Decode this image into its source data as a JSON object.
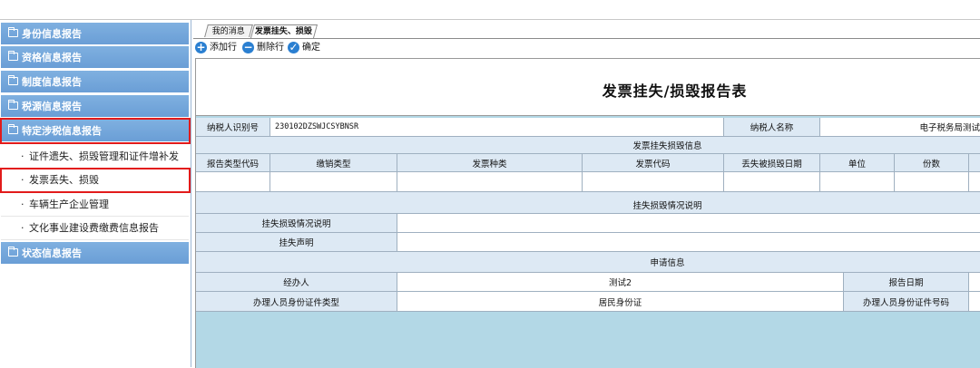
{
  "sidebar": {
    "groups": [
      {
        "label": "身份信息报告"
      },
      {
        "label": "资格信息报告"
      },
      {
        "label": "制度信息报告"
      },
      {
        "label": "税源信息报告"
      },
      {
        "label": "特定涉税信息报告"
      },
      {
        "label": "状态信息报告"
      }
    ],
    "items": [
      {
        "bullet": "·",
        "label": "证件遗失、损毁管理和证件增补发"
      },
      {
        "bullet": "·",
        "label": "发票丢失、损毁"
      },
      {
        "bullet": "·",
        "label": "车辆生产企业管理"
      },
      {
        "bullet": "·",
        "label": "文化事业建设费缴费信息报告"
      }
    ]
  },
  "tabs": [
    {
      "label": "我的消息"
    },
    {
      "label": "发票挂失、损毁"
    }
  ],
  "toolbar": {
    "add": "添加行",
    "delete": "删除行",
    "confirm": "确定"
  },
  "form": {
    "title": "发票挂失/损毁报告表",
    "taxpayer_id_label": "纳税人识别号",
    "taxpayer_id_value": "230102DZSWJCSYBNSR",
    "taxpayer_name_label": "纳税人名称",
    "taxpayer_name_value": "电子税务局测试",
    "section1": "发票挂失损毁信息",
    "columns": [
      "报告类型代码",
      "缴销类型",
      "发票种类",
      "发票代码",
      "丢失被损毁日期",
      "单位",
      "份数"
    ],
    "section2": "挂失损毁情况说明",
    "explain_label": "挂失损毁情况说明",
    "declaration_label": "挂失声明",
    "section3": "申请信息",
    "agent_label": "经办人",
    "agent_value": "测试2",
    "report_date_label": "报告日期",
    "id_type_label": "办理人员身份证件类型",
    "id_type_value": "居民身份证",
    "id_no_label": "办理人员身份证件号码"
  },
  "colors": {
    "sidebar_header": "#6a9ed6",
    "highlight_border": "#e21b1b",
    "label_cell": "#dde9f4",
    "form_background": "#b3d8e6",
    "toolbar_icon": "#2a7fd1"
  }
}
